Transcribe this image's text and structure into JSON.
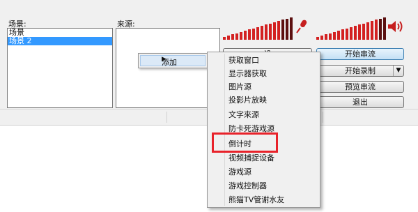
{
  "scenes": {
    "label": "场景:",
    "items": [
      "场景",
      "场景 2"
    ],
    "selected_index": 1
  },
  "sources": {
    "label": "来源:"
  },
  "meters": {
    "mic_level": 0.85,
    "desktop_level": 0.9,
    "mic_icon": "microphone-icon",
    "speaker_icon": "speaker-icon",
    "bar_color": "#d32020"
  },
  "buttons": {
    "start_stream": "开始串流",
    "start_record": "开始录制",
    "preview_stream": "预览串流",
    "exit": "退出",
    "settings_partial": "设"
  },
  "context_menu": {
    "add_label": "添加",
    "items": [
      "获取窗口",
      "显示器获取",
      "图片源",
      "投影片放映",
      "文字來源",
      "防卡死游戏源",
      "倒计时",
      "视频捕捉设备",
      "游戏源",
      "游戏控制器",
      "熊猫TV管谢水友"
    ],
    "highlighted_item": "倒计时",
    "highlight_color": "#e8222a"
  }
}
